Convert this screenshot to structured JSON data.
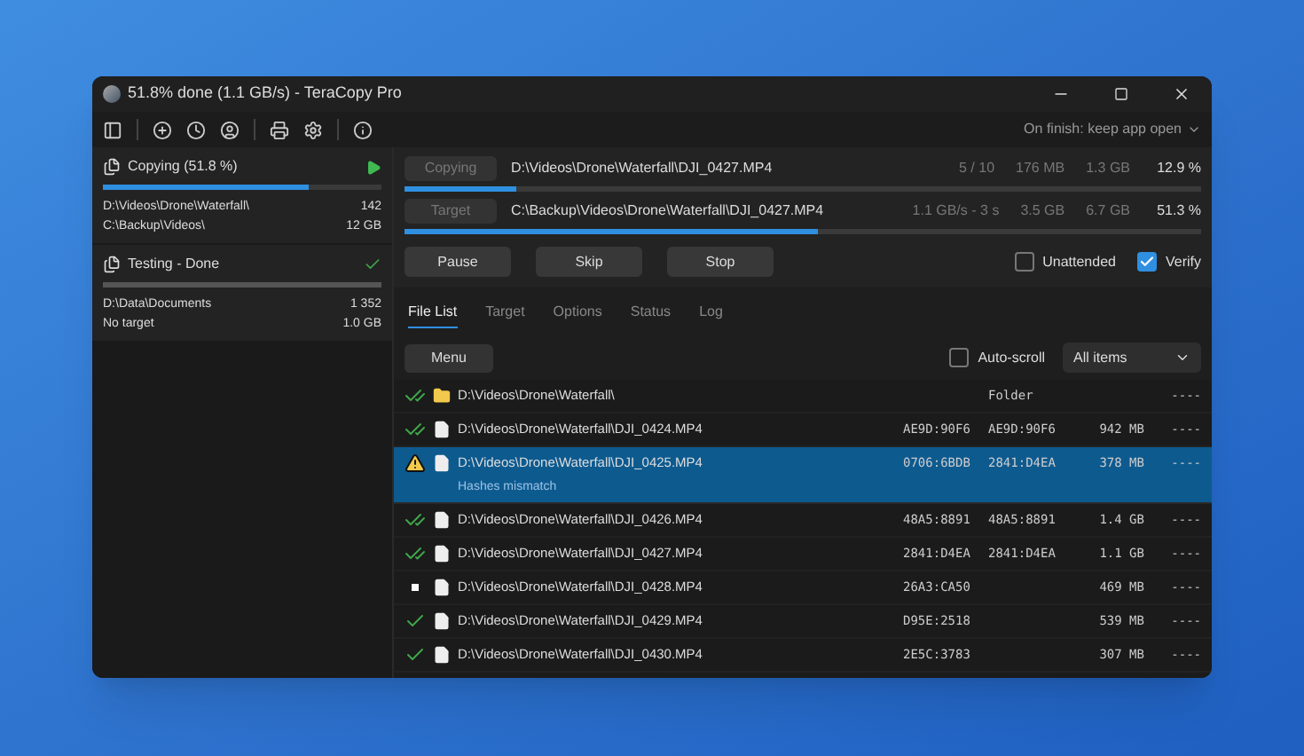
{
  "window": {
    "title": "51.8% done (1.1 GB/s) - TeraCopy Pro"
  },
  "toolbar": {
    "on_finish": "On finish: keep app open"
  },
  "jobs": [
    {
      "title": "Copying (51.8 %)",
      "kind": "running",
      "level": 0.74,
      "source": "D:\\Videos\\Drone\\Waterfall\\",
      "count": "142",
      "target": "C:\\Backup\\Videos\\",
      "size": "12 GB"
    },
    {
      "title": "Testing - Done",
      "kind": "done",
      "level": 1,
      "source": "D:\\Data\\Documents",
      "count": "1 352",
      "target": "No target",
      "size": "1.0 GB"
    }
  ],
  "progress": [
    {
      "label": "Copying",
      "disabled": true,
      "path": "D:\\Videos\\Drone\\Waterfall\\DJI_0427.MP4",
      "stats": [
        "5 / 10",
        "176 MB",
        "1.3 GB"
      ],
      "percent": "12.9 %",
      "level": 0.14
    },
    {
      "label": "Target",
      "disabled": true,
      "path": "C:\\Backup\\Videos\\Drone\\Waterfall\\DJI_0427.MP4",
      "stats": [
        "1.1 GB/s - 3 s",
        "3.5 GB",
        "6.7 GB"
      ],
      "percent": "51.3 %",
      "level": 0.52
    }
  ],
  "actions": [
    "Pause",
    "Skip",
    "Stop"
  ],
  "options": [
    {
      "label": "Unattended",
      "checked": false
    },
    {
      "label": "Verify",
      "checked": true
    }
  ],
  "tabs": [
    {
      "label": "File List",
      "selected": true
    },
    {
      "label": "Target",
      "selected": false
    },
    {
      "label": "Options",
      "selected": false
    },
    {
      "label": "Status",
      "selected": false
    },
    {
      "label": "Log",
      "selected": false
    }
  ],
  "list_toolbar": {
    "menu": "Menu",
    "auto_scroll": {
      "label": "Auto-scroll",
      "checked": false
    },
    "filter": "All items"
  },
  "files": [
    {
      "kind": "verified",
      "icon": {
        "kind": "folder"
      },
      "path": "D:\\Videos\\Drone\\Waterfall\\",
      "hash_2": "Folder",
      "extra": "----",
      "selected": false
    },
    {
      "kind": "verified",
      "icon": {
        "kind": "file"
      },
      "path": "D:\\Videos\\Drone\\Waterfall\\DJI_0424.MP4",
      "hash_1": "AE9D:90F6",
      "hash_2": "AE9D:90F6",
      "size": "942 MB",
      "extra": "----",
      "selected": false
    },
    {
      "kind": "warning",
      "icon": {
        "kind": "file"
      },
      "path": "D:\\Videos\\Drone\\Waterfall\\DJI_0425.MP4",
      "note": "Hashes mismatch",
      "hash_1": "0706:6BDB",
      "hash_2": "2841:D4EA",
      "size": "378 MB",
      "extra": "----",
      "selected": true
    },
    {
      "kind": "verified",
      "icon": {
        "kind": "file"
      },
      "path": "D:\\Videos\\Drone\\Waterfall\\DJI_0426.MP4",
      "hash_1": "48A5:8891",
      "hash_2": "48A5:8891",
      "size": "1.4 GB",
      "extra": "----",
      "selected": false
    },
    {
      "kind": "verified",
      "icon": {
        "kind": "file"
      },
      "path": "D:\\Videos\\Drone\\Waterfall\\DJI_0427.MP4",
      "hash_1": "2841:D4EA",
      "hash_2": "2841:D4EA",
      "size": "1.1 GB",
      "extra": "----",
      "selected": false
    },
    {
      "kind": "pending",
      "icon": {
        "kind": "file"
      },
      "path": "D:\\Videos\\Drone\\Waterfall\\DJI_0428.MP4",
      "hash_1": "26A3:CA50",
      "size": "469 MB",
      "extra": "----",
      "selected": false
    },
    {
      "kind": "copied",
      "icon": {
        "kind": "file"
      },
      "path": "D:\\Videos\\Drone\\Waterfall\\DJI_0429.MP4",
      "hash_1": "D95E:2518",
      "size": "539 MB",
      "extra": "----",
      "selected": false
    },
    {
      "kind": "copied",
      "icon": {
        "kind": "file"
      },
      "path": "D:\\Videos\\Drone\\Waterfall\\DJI_0430.MP4",
      "hash_1": "2E5C:3783",
      "size": "307 MB",
      "extra": "----",
      "selected": false
    }
  ]
}
